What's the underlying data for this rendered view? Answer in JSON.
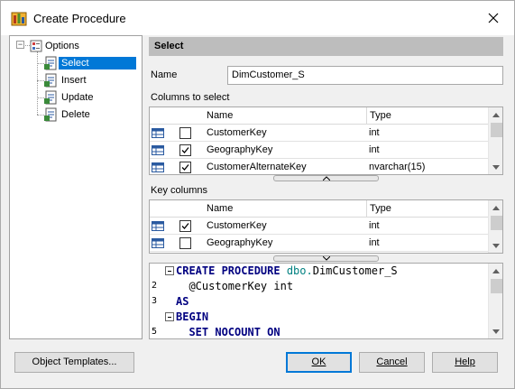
{
  "window": {
    "title": "Create Procedure"
  },
  "tree": {
    "root": "Options",
    "items": [
      {
        "label": "Select",
        "selected": true
      },
      {
        "label": "Insert",
        "selected": false
      },
      {
        "label": "Update",
        "selected": false
      },
      {
        "label": "Delete",
        "selected": false
      }
    ]
  },
  "section": {
    "title": "Select"
  },
  "name_field": {
    "label": "Name",
    "value": "DimCustomer_S"
  },
  "columns_grid": {
    "title": "Columns to select",
    "headers": {
      "name": "Name",
      "type": "Type"
    },
    "rows": [
      {
        "checked": false,
        "name": "CustomerKey",
        "type": "int"
      },
      {
        "checked": true,
        "name": "GeographyKey",
        "type": "int"
      },
      {
        "checked": true,
        "name": "CustomerAlternateKey",
        "type": "nvarchar(15)"
      }
    ]
  },
  "key_grid": {
    "title": "Key columns",
    "headers": {
      "name": "Name",
      "type": "Type"
    },
    "rows": [
      {
        "checked": true,
        "name": "CustomerKey",
        "type": "int"
      },
      {
        "checked": false,
        "name": "GeographyKey",
        "type": "int"
      }
    ]
  },
  "code": {
    "lines": [
      {
        "num": "",
        "fold": true,
        "kw": "CREATE PROCEDURE ",
        "obj": "dbo.",
        "rest": "DimCustomer_S"
      },
      {
        "num": "2",
        "fold": false,
        "text": "  @CustomerKey int"
      },
      {
        "num": "3",
        "fold": false,
        "text": "AS"
      },
      {
        "num": "",
        "fold": true,
        "text": "BEGIN"
      },
      {
        "num": "5",
        "fold": false,
        "text": "  SET NOCOUNT ON"
      }
    ]
  },
  "buttons": {
    "templates": "Object Templates...",
    "ok": "OK",
    "cancel": "Cancel",
    "help": "Help"
  },
  "colors": {
    "selection": "#0078d7",
    "header_bg": "#bdbdbd",
    "keyword": "#000080",
    "schema": "#008080"
  }
}
